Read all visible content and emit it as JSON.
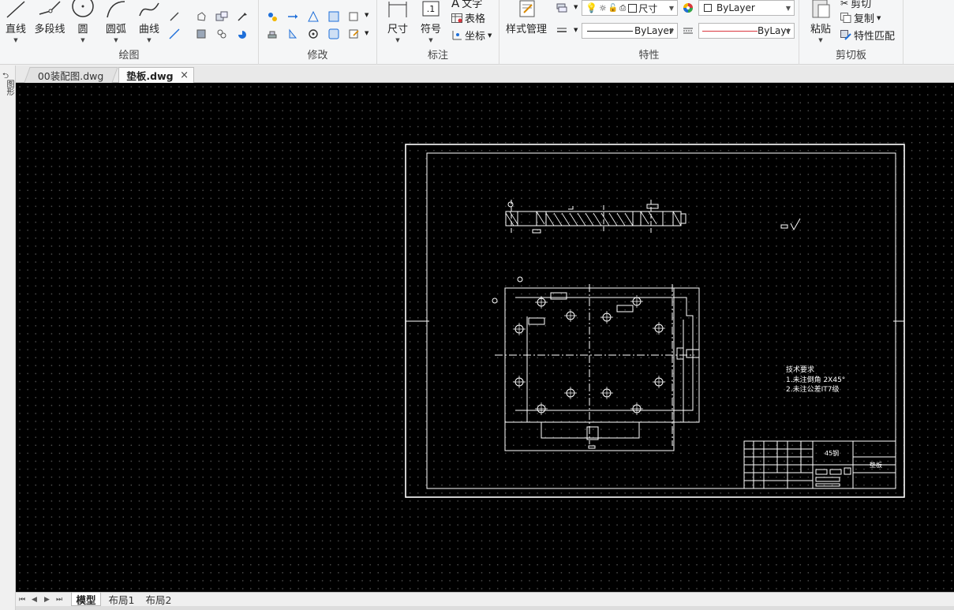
{
  "ribbon": {
    "draw": {
      "title": "绘图",
      "line": "直线",
      "polyline": "多段线",
      "circle": "圆",
      "arc": "圆弧",
      "spline": "曲线"
    },
    "modify": {
      "title": "修改"
    },
    "annotation": {
      "title": "标注",
      "dimension": "尺寸",
      "symbol": "符号",
      "text": "文字",
      "table": "表格",
      "coord": "坐标"
    },
    "properties": {
      "title": "特性",
      "style_manager": "样式管理",
      "layer_value": "尺寸",
      "color_value": "ByLayer",
      "linetype_value": "ByLayer",
      "lineweight_value": "ByLayer"
    },
    "clipboard": {
      "title": "剪切板",
      "paste": "粘贴",
      "cut": "剪切",
      "copy": "复制",
      "match_props": "特性匹配"
    }
  },
  "tabs": [
    {
      "label": "00装配图.dwg"
    },
    {
      "label": "垫板.dwg",
      "close": "×"
    }
  ],
  "left_strip": {
    "label": "图形"
  },
  "drawing": {
    "tech_req_title": "技术要求",
    "tech_req_1": "1.未注倒角  2X45°",
    "tech_req_2": "2.未注公差IT7级",
    "material": "45钢",
    "part_name": "垫板"
  },
  "bottom": {
    "tabs": [
      "模型",
      "布局1",
      "布局2"
    ],
    "nav": [
      "⏮",
      "◀",
      "▶",
      "⏭"
    ]
  },
  "colors": {
    "canvas": "#000000",
    "drawing_line": "#ffffff",
    "linetype_red": "#d9363e"
  }
}
